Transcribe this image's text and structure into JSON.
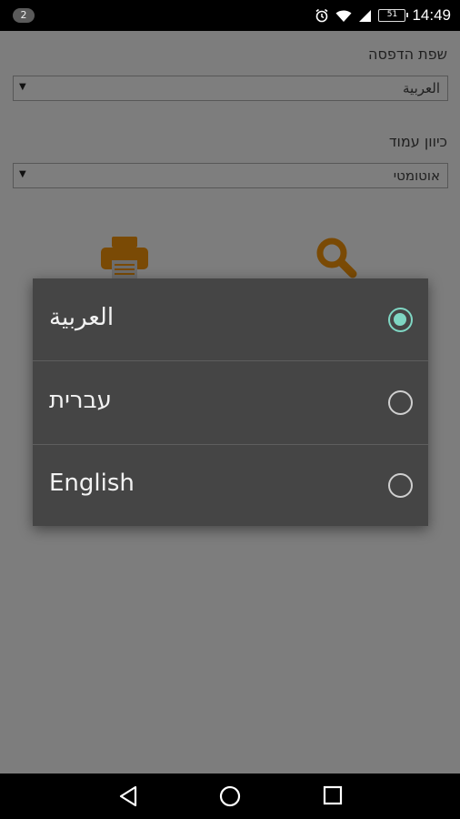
{
  "status_bar": {
    "notification_count": "2",
    "battery_level": "51",
    "time": "14:49",
    "icons": [
      "alarm-icon",
      "wifi-icon",
      "signal-icon",
      "battery-icon"
    ]
  },
  "page": {
    "print_language": {
      "label": "שפת הדפסה",
      "value": "العربية"
    },
    "page_orientation": {
      "label": "כיוון עמוד",
      "value": "אוטומטי"
    },
    "icons": [
      "printer-icon",
      "search-icon"
    ],
    "icon_color": "#7a4a05"
  },
  "dialog": {
    "options": [
      {
        "label": "العربية",
        "selected": true
      },
      {
        "label": "עברית",
        "selected": false
      },
      {
        "label": "English",
        "selected": false
      }
    ],
    "accent_color": "#7fd6c3"
  },
  "nav_bar": {
    "buttons": [
      "back-icon",
      "home-icon",
      "recents-icon"
    ]
  }
}
